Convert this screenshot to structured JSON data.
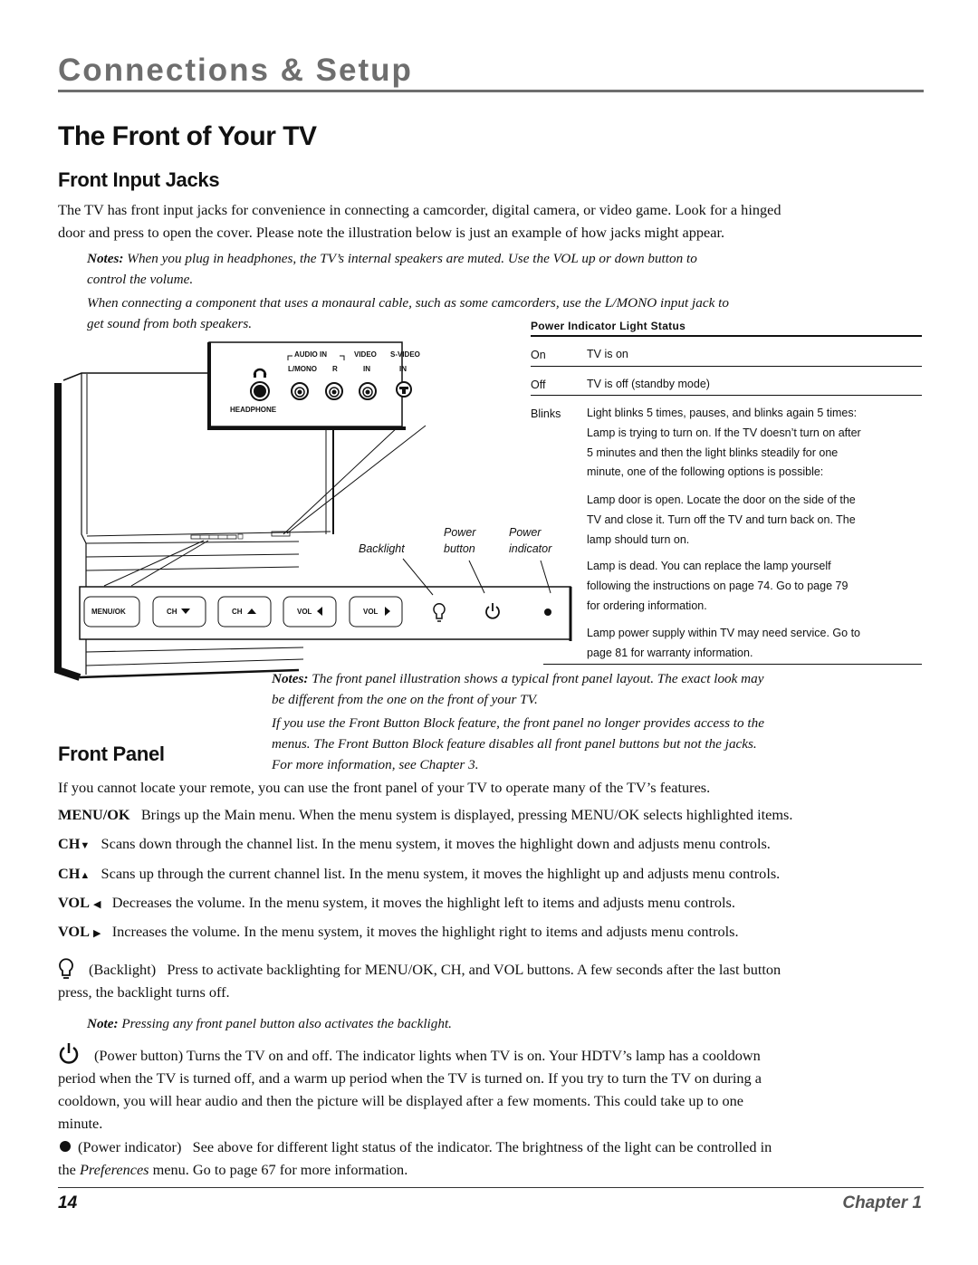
{
  "header": {
    "section": "Connections & Setup",
    "title": "The Front of Your TV"
  },
  "front_input_jacks": {
    "heading": "Front Input Jacks",
    "intro_line1": "The TV has front input jacks for convenience in connecting a camcorder, digital camera, or video game. Look for a hinged",
    "intro_line2": "door and press to open the cover. Please note the illustration below is just an example of how jacks might appear.",
    "note1_label": "Notes:",
    "note1_line1": " When you plug in headphones, the TV’s internal speakers are muted. Use the VOL up or down button to",
    "note1_line2": "control the volume.",
    "note2_line1": "When connecting a component that uses a monaural cable, such as some camcorders, use the L/MONO input jack to",
    "note2_line2": "get sound from both speakers."
  },
  "diagram": {
    "jack_panel": {
      "audio_in": "AUDIO IN",
      "l_mono": "L/MONO",
      "r": "R",
      "video": "VIDEO",
      "video_in": "IN",
      "s_video": "S-VIDEO",
      "s_video_in": "IN",
      "headphone": "HEADPHONE"
    },
    "buttons": [
      "MENU/OK",
      "CH",
      "CH",
      "VOL",
      "VOL"
    ],
    "callouts": {
      "backlight": "Backlight",
      "power_button_1": "Power",
      "power_button_2": "button",
      "power_indicator_1": "Power",
      "power_indicator_2": "indicator"
    }
  },
  "power_indicator_table": {
    "title": "Power Indicator Light Status",
    "rows": [
      {
        "state": "On",
        "lines": [
          "TV is on"
        ]
      },
      {
        "state": "Off",
        "lines": [
          "TV is off  (standby mode)"
        ]
      },
      {
        "state": "Blinks",
        "lines": [
          "Light blinks 5 times, pauses, and blinks again 5 times:",
          "Lamp is trying to turn on. If the TV doesn’t turn on after",
          "5 minutes and then the light blinks steadily for one",
          "minute, one of the following options is possible:"
        ]
      }
    ],
    "options": [
      [
        "Lamp door is open. Locate the door on the side of the",
        "TV and close it. Turn off the TV and turn back on. The",
        "lamp should turn on."
      ],
      [
        "Lamp is dead. You can replace the lamp yourself",
        "following the instructions on page 74. Go to page 79",
        "for ordering information."
      ],
      [
        "Lamp power supply within TV may need service. Go to",
        "page 81 for warranty information."
      ]
    ]
  },
  "panel_notes": {
    "label": "Notes:",
    "line1": " The front panel illustration shows a typical front panel layout. The exact look may",
    "line2": "be different from the one on the front of your TV.",
    "line3": "If you use the Front Button Block feature, the front panel no longer provides access to the",
    "line4": "menus. The Front Button Block feature disables all front panel buttons but not the jacks.",
    "line5": "For more information, see Chapter 3."
  },
  "front_panel": {
    "heading": "Front Panel",
    "intro": "If you cannot locate your remote, you can use the front panel of your TV to operate many of the TV’s features.",
    "controls": [
      {
        "key": "MENU/OK",
        "glyph": "",
        "desc": "Brings up the Main menu. When the menu system is displayed, pressing MENU/OK selects highlighted items."
      },
      {
        "key": "CH",
        "glyph": "▼",
        "desc": "Scans down through the channel list. In the menu system, it moves the highlight down and adjusts menu controls."
      },
      {
        "key": "CH",
        "glyph": "▲",
        "desc": "Scans up through the current channel list. In the menu system, it moves the highlight up and adjusts menu controls."
      },
      {
        "key": "VOL",
        "glyph": "◀",
        "desc": "Decreases the volume. In the menu system, it moves the highlight left to items and adjusts menu controls."
      },
      {
        "key": "VOL",
        "glyph": "▶",
        "desc": "Increases the volume. In the menu system, it moves the highlight right to items and adjusts menu controls."
      }
    ],
    "backlight_label": "(Backlight)",
    "backlight_line1": "Press to activate backlighting for MENU/OK, CH, and VOL buttons. A few seconds after the last button",
    "backlight_line2": "press, the backlight turns off.",
    "backlight_note_label": "Note:",
    "backlight_note": " Pressing any front panel button also activates the backlight.",
    "power_line1": "(Power button) Turns the TV on and off. The indicator lights when TV is on. Your HDTV’s lamp has a cooldown",
    "power_line2": "period when the TV is turned off, and a warm up period when the TV is turned on. If you try to turn the TV on during a",
    "power_line3": "cooldown, you will hear audio and then the picture will be displayed after a few moments. This could take up to one",
    "power_line4": "minute.",
    "indicator_label": "(Power indicator)",
    "indicator_line1": "See above for different light status of the indicator. The brightness of the light can be controlled in",
    "indicator_line2_pre": "the ",
    "indicator_line2_em": "Preferences",
    "indicator_line2_post": " menu. Go to page 67 for more information."
  },
  "footer": {
    "page_number": "14",
    "chapter": "Chapter 1"
  }
}
